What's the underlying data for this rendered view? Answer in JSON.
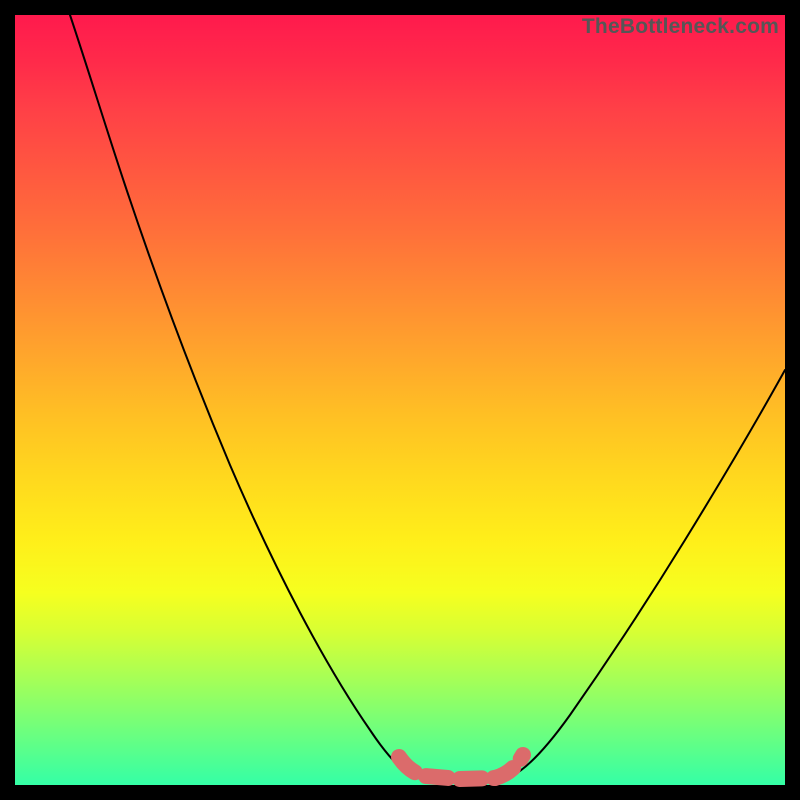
{
  "watermark": "TheBottleneck.com",
  "chart_data": {
    "type": "line",
    "title": "",
    "xlabel": "",
    "ylabel": "",
    "xlim": [
      0,
      100
    ],
    "ylim": [
      0,
      100
    ],
    "grid": false,
    "series": [
      {
        "name": "bottleneck-curve",
        "x": [
          7,
          10,
          15,
          20,
          25,
          30,
          35,
          40,
          45,
          49,
          52,
          55,
          58,
          61,
          64,
          68,
          73,
          80,
          88,
          96,
          100
        ],
        "values": [
          100,
          93,
          83,
          73,
          63,
          53,
          43,
          33,
          22,
          11,
          4,
          1,
          0.5,
          0.5,
          1,
          4,
          12,
          24,
          38,
          51,
          58
        ]
      }
    ],
    "annotations": [
      {
        "name": "optimal-plateau",
        "x_range": [
          50,
          65
        ],
        "y": 0.5
      }
    ]
  }
}
